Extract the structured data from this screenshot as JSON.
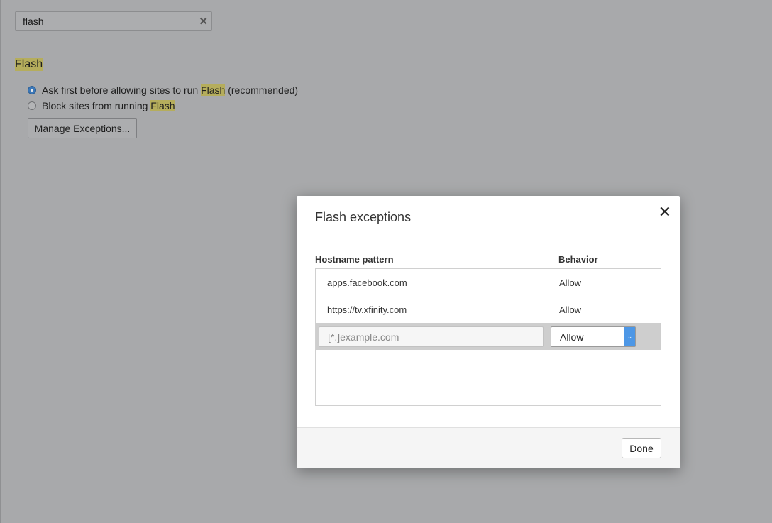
{
  "search": {
    "value": "flash",
    "clear_icon": "close-icon"
  },
  "section": {
    "title": "Flash",
    "options": [
      {
        "before": "Ask first before allowing sites to run ",
        "highlight": "Flash",
        "after": " (recommended)",
        "selected": true
      },
      {
        "before": "Block sites from running ",
        "highlight": "Flash",
        "after": "",
        "selected": false
      }
    ],
    "manage_label": "Manage Exceptions..."
  },
  "dialog": {
    "title": "Flash exceptions",
    "close_glyph": "✕",
    "col_hostname": "Hostname pattern",
    "col_behavior": "Behavior",
    "rows": [
      {
        "hostname": "apps.facebook.com",
        "behavior": "Allow"
      },
      {
        "hostname": "https://tv.xfinity.com",
        "behavior": "Allow"
      }
    ],
    "new_placeholder": "[*.]example.com",
    "new_behavior": "Allow",
    "done_label": "Done"
  },
  "colors": {
    "highlight": "#b5ad5c",
    "accent": "#4d97e6",
    "overlay": "#a8a9ab"
  }
}
